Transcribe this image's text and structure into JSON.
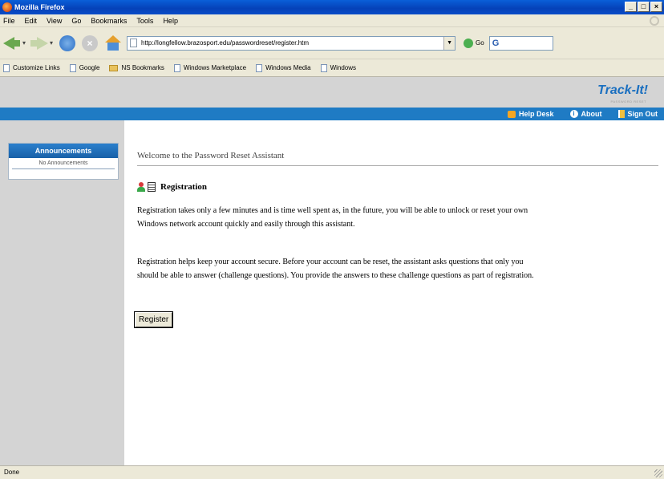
{
  "window": {
    "title": "Mozilla Firefox"
  },
  "menu": [
    "File",
    "Edit",
    "View",
    "Go",
    "Bookmarks",
    "Tools",
    "Help"
  ],
  "navbar": {
    "url": "http://longfellow.brazosport.edu/passwordreset/register.htm",
    "go_label": "Go",
    "search_value": "G"
  },
  "bookmarks": [
    {
      "label": "Customize Links",
      "icon": "page-icon"
    },
    {
      "label": "Google",
      "icon": "page-icon"
    },
    {
      "label": "NS Bookmarks",
      "icon": "folder-icon"
    },
    {
      "label": "Windows Marketplace",
      "icon": "page-icon"
    },
    {
      "label": "Windows Media",
      "icon": "page-icon"
    },
    {
      "label": "Windows",
      "icon": "page-icon"
    }
  ],
  "brand": {
    "logo": "Track-It!",
    "tagline": "PASSWORD RESET"
  },
  "topnav": {
    "help_desk": "Help Desk",
    "about": "About",
    "sign_out": "Sign Out"
  },
  "sidebar": {
    "announcements_title": "Announcements",
    "announcements_empty": "No Announcements"
  },
  "main": {
    "welcome": "Welcome to the Password Reset Assistant",
    "heading": "Registration",
    "para1": "Registration takes only a few minutes and is time well spent as, in the future, you will be able to unlock or reset your own Windows network account quickly and easily through this assistant.",
    "para2": "Registration helps keep your account secure. Before your account can be reset, the assistant asks questions that only you should be able to answer (challenge questions). You provide the answers to these challenge questions as part of registration.",
    "register_button": "Register"
  },
  "status": {
    "text": "Done"
  }
}
